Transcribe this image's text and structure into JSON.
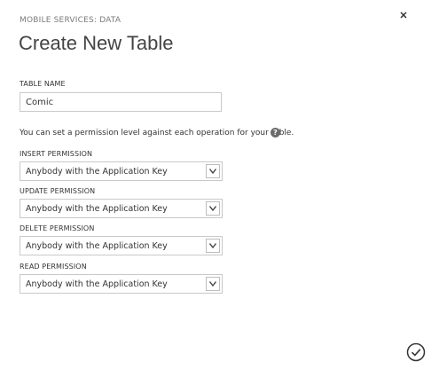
{
  "dialog": {
    "breadcrumb": "MOBILE SERVICES: DATA",
    "title": "Create New Table",
    "close_icon": "close-icon"
  },
  "table_name": {
    "label": "TABLE NAME",
    "value": "Comic"
  },
  "permission_info": "You can set a permission level against each operation for your table.",
  "help_icon": "?",
  "permissions": [
    {
      "label": "INSERT PERMISSION",
      "value": "Anybody with the Application Key"
    },
    {
      "label": "UPDATE PERMISSION",
      "value": "Anybody with the Application Key"
    },
    {
      "label": "DELETE PERMISSION",
      "value": "Anybody with the Application Key"
    },
    {
      "label": "READ PERMISSION",
      "value": "Anybody with the Application Key"
    }
  ],
  "confirm_icon": "checkmark-circle-icon"
}
